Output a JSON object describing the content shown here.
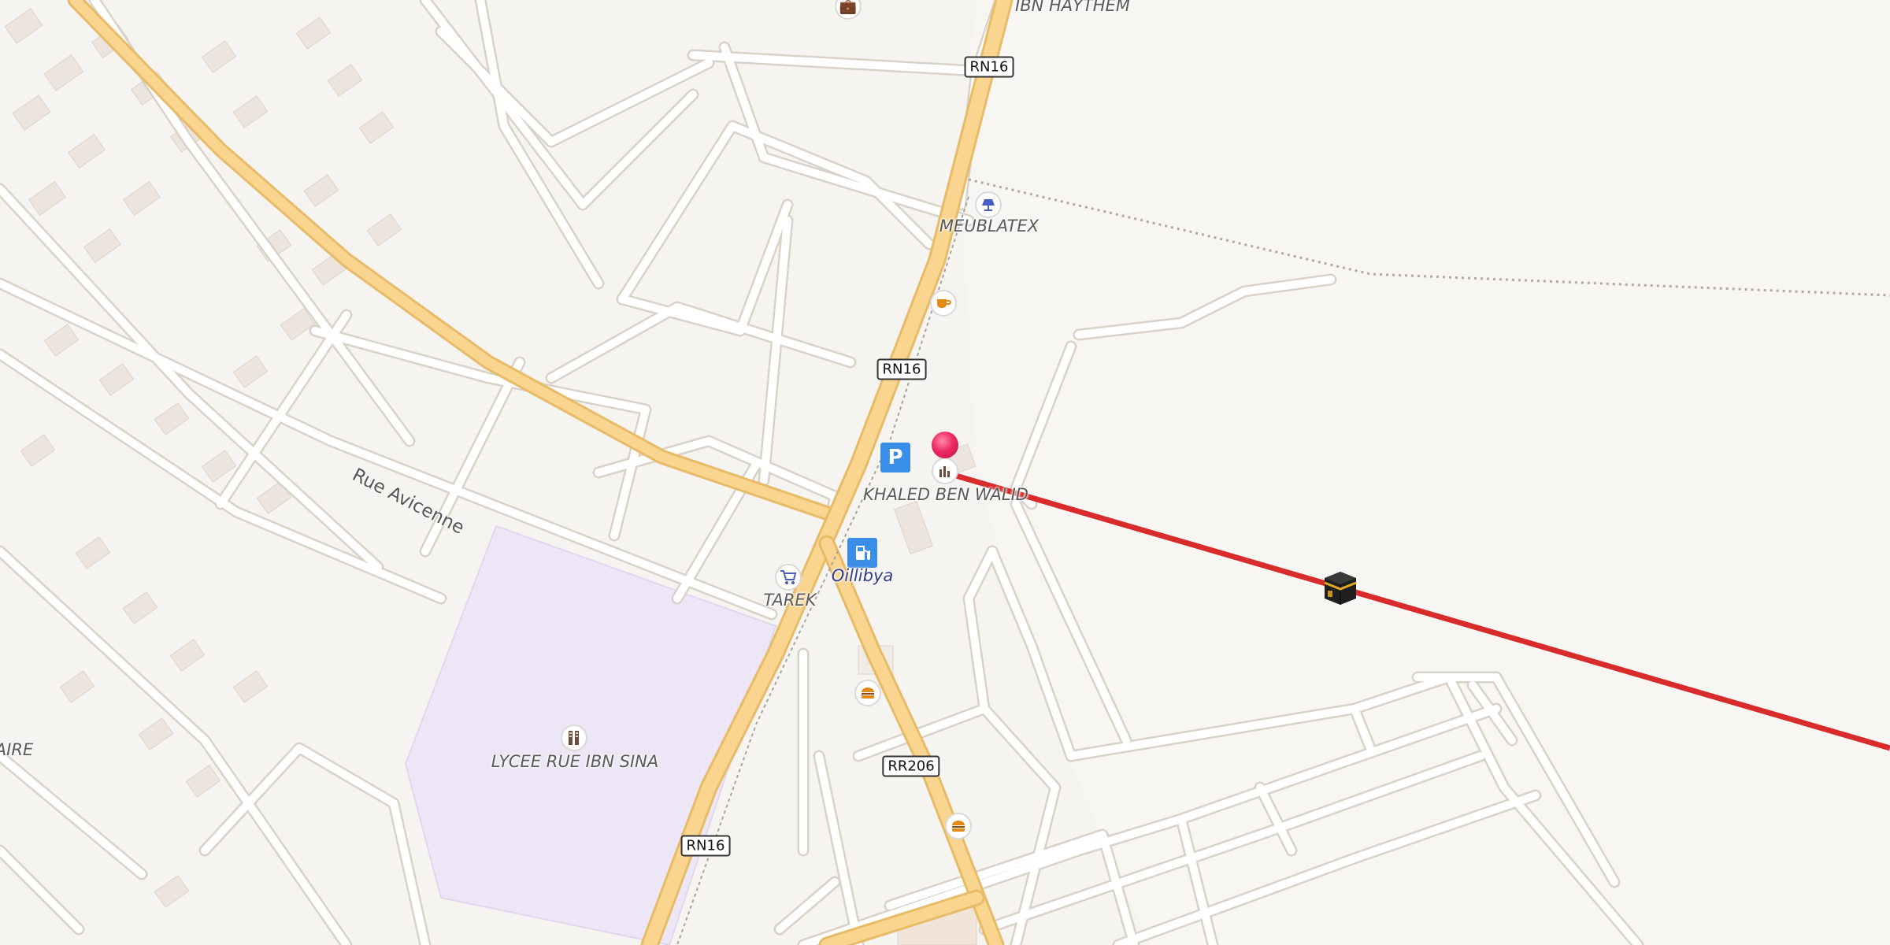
{
  "labels": {
    "ibn_haythem": "IBN HAYTHEM",
    "meublatex": "MEUBLATEX",
    "khaled": "KHALED BEN WALID",
    "oillibya": "Oillibya",
    "tarek": "TAREK",
    "lycee": "LYCEE RUE IBN SINA",
    "aire": "AIRE"
  },
  "streets": {
    "avicenne": "Rue Avicenne"
  },
  "shields": {
    "rn16_top": "RN16",
    "rn16_mid": "RN16",
    "rn16_bottom": "RN16",
    "rr206": "RR206"
  },
  "poi_icons": {
    "briefcase": "briefcase-icon",
    "lamp": "lamp-icon",
    "coffee": "coffee-icon",
    "parking": "parking-icon",
    "fuel": "fuel-icon",
    "shop": "shopping-cart-icon",
    "burger1": "burger-icon",
    "burger2": "burger-icon",
    "school": "school-icon",
    "monument": "monument-icon",
    "kaaba": "kaaba-icon",
    "pin": "location-pin-icon"
  },
  "parking_letter": "P",
  "colors": {
    "background": "#f6f4f1",
    "road_main": "#f9d58f",
    "road_edge": "#e7bb68",
    "road_minor": "#ffffff",
    "school_area": "#ece6f6",
    "qibla_line": "#d92b2b",
    "pin": "#ee2a62",
    "parking": "#3b8ee8"
  }
}
